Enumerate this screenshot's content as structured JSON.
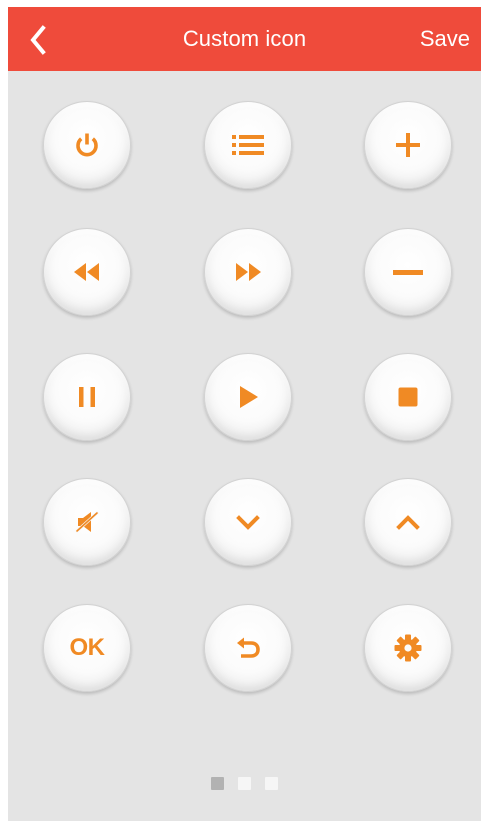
{
  "header": {
    "title": "Custom icon",
    "save_label": "Save",
    "background_color": "#ef4b3b"
  },
  "buttons": [
    [
      {
        "name": "power-button",
        "icon": "power-icon"
      },
      {
        "name": "menu-button",
        "icon": "list-icon"
      },
      {
        "name": "volume-up-button",
        "icon": "plus-icon"
      }
    ],
    [
      {
        "name": "rewind-button",
        "icon": "rewind-icon"
      },
      {
        "name": "fast-forward-button",
        "icon": "fast-forward-icon"
      },
      {
        "name": "volume-down-button",
        "icon": "minus-icon"
      }
    ],
    [
      {
        "name": "pause-button",
        "icon": "pause-icon"
      },
      {
        "name": "play-button",
        "icon": "play-icon"
      },
      {
        "name": "stop-button",
        "icon": "stop-icon"
      }
    ],
    [
      {
        "name": "mute-button",
        "icon": "mute-icon"
      },
      {
        "name": "channel-down-button",
        "icon": "chevron-down-icon"
      },
      {
        "name": "channel-up-button",
        "icon": "chevron-up-icon"
      }
    ],
    [
      {
        "name": "ok-button",
        "icon": "ok-text",
        "label": "OK"
      },
      {
        "name": "return-button",
        "icon": "return-icon"
      },
      {
        "name": "settings-button",
        "icon": "gear-icon"
      }
    ]
  ],
  "pager": {
    "pages": 3,
    "current": 1
  },
  "colors": {
    "icon_orange": "#f08a24",
    "background": "#e4e4e4"
  }
}
